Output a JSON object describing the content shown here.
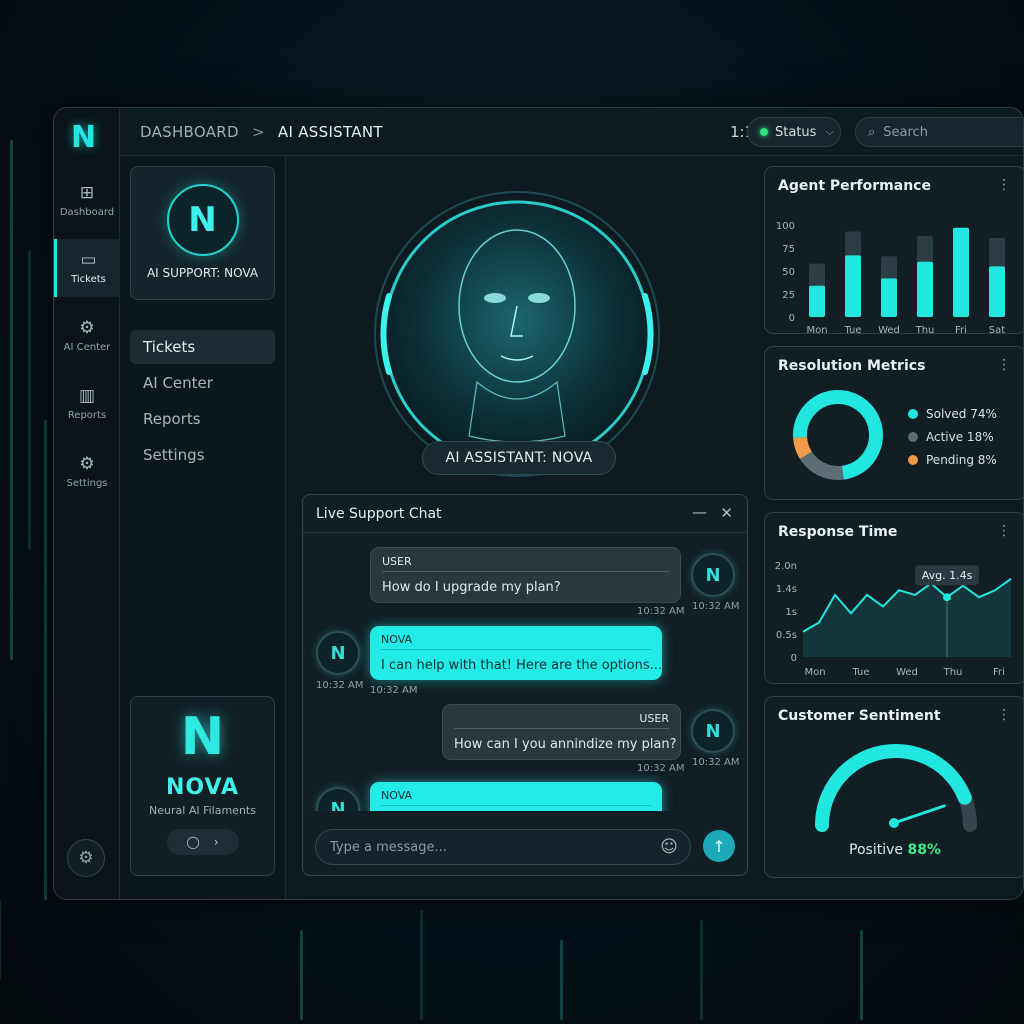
{
  "app": {
    "logo": "N",
    "breadcrumb": {
      "root": "DASHBOARD",
      "separator": ">",
      "current": "AI ASSISTANT"
    },
    "time": "1:10 AM",
    "status": {
      "label": "Status",
      "color": "#2fe27a"
    },
    "search": {
      "placeholder": "Search"
    }
  },
  "rail": {
    "items": [
      {
        "label": "Dashboard",
        "icon": "grid-icon"
      },
      {
        "label": "Tickets",
        "icon": "chat-ticket-icon",
        "active": true
      },
      {
        "label": "AI Center",
        "icon": "gear-icon"
      },
      {
        "label": "Reports",
        "icon": "bar-chart-icon"
      },
      {
        "label": "Settings",
        "icon": "settings-icon"
      }
    ]
  },
  "sidebar": {
    "agent_label": "AI SUPPORT: NOVA",
    "nav": [
      "Tickets",
      "AI Center",
      "Reports",
      "Settings"
    ],
    "brand": {
      "name": "NOVA",
      "subtitle": "Neural AI Filaments"
    }
  },
  "assistant": {
    "label": "AI ASSISTANT: NOVA"
  },
  "chat": {
    "title": "Live Support Chat",
    "messages": [
      {
        "from": "USER",
        "text": "How do I upgrade my plan?",
        "time": "10:32 AM",
        "avatar_time": "10:32 AM"
      },
      {
        "from": "NOVA",
        "text": "I can help with that! Here are the options...",
        "time": "10:32 AM",
        "avatar_time": "10:32 AM"
      },
      {
        "from": "USER",
        "text": "How can I you annindize my plan?",
        "time": "10:32 AM",
        "avatar_time": "10:32 AM"
      },
      {
        "from": "NOVA",
        "text": ""
      }
    ],
    "input_placeholder": "Type a message..."
  },
  "panels": {
    "performance": "Agent Performance",
    "resolution": "Resolution Metrics",
    "response": "Response Time",
    "sentiment": "Customer Sentiment"
  },
  "chart_data": [
    {
      "type": "bar",
      "title": "Agent Performance",
      "categories": [
        "Mon",
        "Tue",
        "Wed",
        "Thu",
        "Fri",
        "Sat"
      ],
      "ylim": [
        0,
        100
      ],
      "yticks": [
        "100",
        "75",
        "50",
        "25",
        "0"
      ],
      "series": [
        {
          "values": [
            58,
            93,
            66,
            88,
            97,
            86
          ]
        },
        {
          "values": [
            34,
            67,
            42,
            60,
            97,
            55
          ]
        }
      ],
      "colors": [
        "#2d4148",
        "#22e6e0"
      ]
    },
    {
      "type": "pie",
      "title": "Resolution Metrics",
      "slices": [
        {
          "label": "Solved 74%",
          "value": 74,
          "color": "#22e6e0"
        },
        {
          "label": "Active 18%",
          "value": 18,
          "color": "#5b6e75"
        },
        {
          "label": "Pending 8%",
          "value": 8,
          "color": "#f2994a"
        }
      ]
    },
    {
      "type": "line",
      "title": "Response Time",
      "x": [
        "Mon",
        "Tue",
        "Wed",
        "Thu",
        "Fri"
      ],
      "yticks": [
        "2.0n",
        "1.4s",
        "1s",
        "0.5s",
        "0"
      ],
      "ylim": [
        0,
        2
      ],
      "values": [
        0.55,
        0.75,
        1.35,
        0.95,
        1.35,
        1.1,
        1.45,
        1.35,
        1.6,
        1.3,
        1.55,
        1.3,
        1.45,
        1.7
      ],
      "annotation": "Avg. 1.4s",
      "color": "#22e6e0"
    },
    {
      "type": "gauge",
      "title": "Customer Sentiment",
      "label": "Positive",
      "value_text": "88%",
      "value": 0.88,
      "color": "#22e6e0"
    }
  ]
}
